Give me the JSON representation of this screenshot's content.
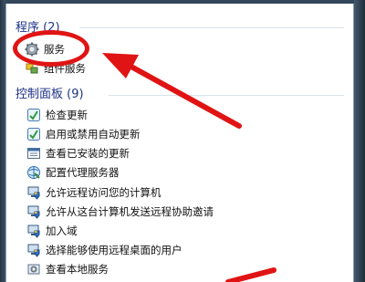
{
  "groups": [
    {
      "title": "程序 (2)",
      "items": [
        {
          "label": "服务",
          "icon": "services-gear-icon"
        },
        {
          "label": "组件服务",
          "icon": "component-services-icon"
        }
      ]
    },
    {
      "title": "控制面板 (9)",
      "items": [
        {
          "label": "检查更新",
          "icon": "windows-update-icon"
        },
        {
          "label": "启用或禁用自动更新",
          "icon": "windows-update-icon"
        },
        {
          "label": "查看已安装的更新",
          "icon": "installed-updates-icon"
        },
        {
          "label": "配置代理服务器",
          "icon": "internet-options-icon"
        },
        {
          "label": "允许远程访问您的计算机",
          "icon": "system-shield-icon"
        },
        {
          "label": "允许从这台计算机发送远程协助邀请",
          "icon": "system-shield-icon"
        },
        {
          "label": "加入域",
          "icon": "system-shield-icon"
        },
        {
          "label": "选择能够使用远程桌面的用户",
          "icon": "system-shield-icon"
        },
        {
          "label": "查看本地服务",
          "icon": "admin-tools-icon"
        }
      ]
    }
  ],
  "colors": {
    "header": "#1e3287",
    "annotation": "#e01414",
    "frame": "#2e4255"
  }
}
